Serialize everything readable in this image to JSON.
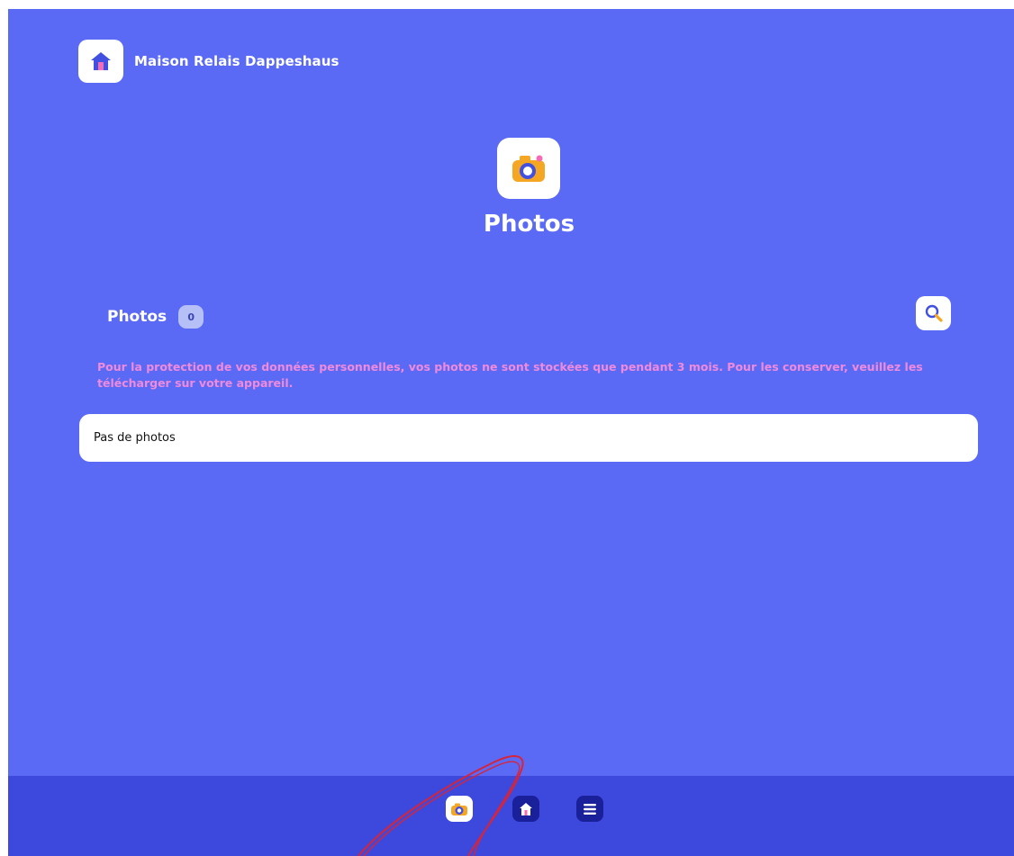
{
  "header": {
    "org_name": "Maison Relais Dappeshaus",
    "logo_icon": "house-icon"
  },
  "page": {
    "icon": "camera-icon",
    "title": "Photos"
  },
  "section": {
    "title": "Photos",
    "count": "0",
    "search_icon": "search-icon"
  },
  "notice": "Pour la protection de vos données personnelles, vos photos ne sont stockées que pendant 3 mois. Pour les conserver, veuillez les télécharger sur votre appareil.",
  "empty_state": "Pas de photos",
  "bottom_nav": {
    "items": [
      {
        "icon": "camera-icon",
        "active": true
      },
      {
        "icon": "house-icon",
        "active": false
      },
      {
        "icon": "menu-icon",
        "active": false
      }
    ]
  },
  "colors": {
    "background": "#5b6af5",
    "nav_bar": "#3d49dc",
    "nav_button": "#1a1f9a",
    "notice_text": "#f08adc",
    "badge": "#b6c0f6",
    "camera_body": "#f5a623",
    "camera_lens": "#4150e0",
    "annotation": "#d6243a"
  }
}
